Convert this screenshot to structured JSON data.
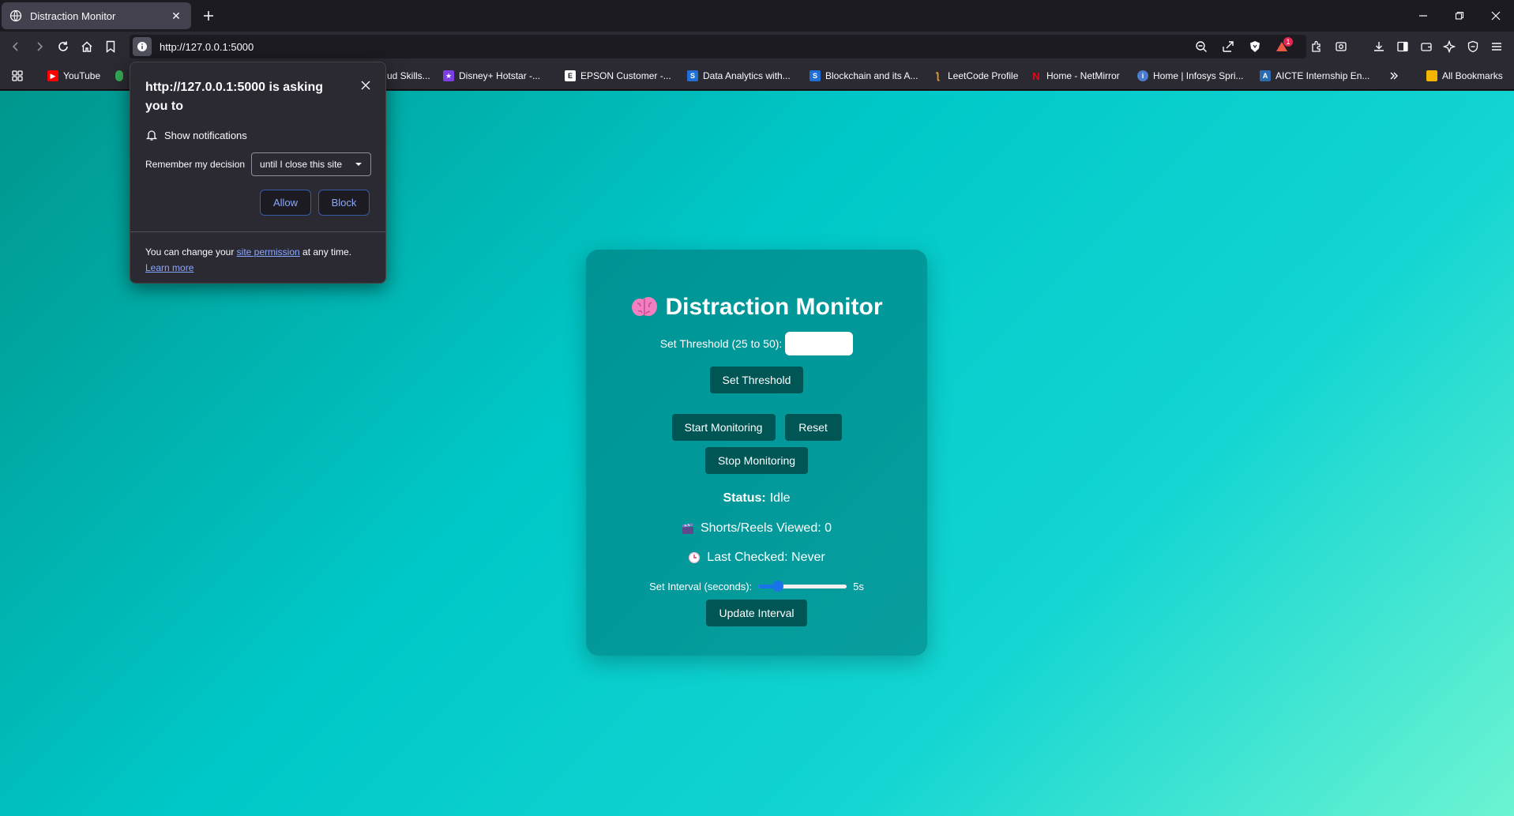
{
  "tab": {
    "title": "Distraction Monitor"
  },
  "nav": {
    "url": "http://127.0.0.1:5000",
    "extension_badge": "1"
  },
  "bookmarks": [
    {
      "label": "YouTube",
      "icon": "youtube-icon",
      "color": "#ff0000"
    },
    {
      "label": "ud Skills...",
      "icon": "google-cloud-icon",
      "color": "#4285f4"
    },
    {
      "label": "Disney+ Hotstar -...",
      "icon": "hotstar-icon",
      "color": "#7b3fe4"
    },
    {
      "label": "EPSON Customer -...",
      "icon": "epson-icon",
      "color": "#ffffff"
    },
    {
      "label": "Data Analytics with...",
      "icon": "simplilearn-icon",
      "color": "#1f6fd6"
    },
    {
      "label": "Blockchain and its A...",
      "icon": "simplilearn-icon",
      "color": "#1f6fd6"
    },
    {
      "label": "LeetCode Profile",
      "icon": "leetcode-icon",
      "color": "#ffa116"
    },
    {
      "label": "Home - NetMirror",
      "icon": "netmirror-icon",
      "color": "#e50914"
    },
    {
      "label": "Home | Infosys Spri...",
      "icon": "infosys-icon",
      "color": "#4b7cc9"
    },
    {
      "label": "AICTE Internship En...",
      "icon": "aicte-icon",
      "color": "#2b6cb0"
    }
  ],
  "bookmarks_all": "All Bookmarks",
  "app": {
    "title": "Distraction Monitor",
    "threshold_label": "Set Threshold (25 to 50):",
    "threshold_value": "",
    "set_threshold": "Set Threshold",
    "start": "Start Monitoring",
    "reset": "Reset",
    "stop": "Stop Monitoring",
    "status_label": "Status:",
    "status_value": "Idle",
    "shorts_viewed": "Shorts/Reels Viewed: 0",
    "last_checked": "Last Checked: Never",
    "interval_label": "Set Interval (seconds):",
    "interval_value": "5s",
    "interval_slider_fraction": 0.18,
    "update_interval": "Update Interval"
  },
  "popup": {
    "title": "http://127.0.0.1:5000 is asking you to",
    "permission": "Show notifications",
    "remember_label": "Remember my decision",
    "remember_option": "until I close this site",
    "allow": "Allow",
    "block": "Block",
    "footer_pre": "You can change your ",
    "footer_link": "site permission",
    "footer_post": " at any time.",
    "learn_more": "Learn more"
  },
  "colors": {
    "button": "#005555",
    "accent_link": "#8aa8ff",
    "slider": "#1a73e8"
  }
}
